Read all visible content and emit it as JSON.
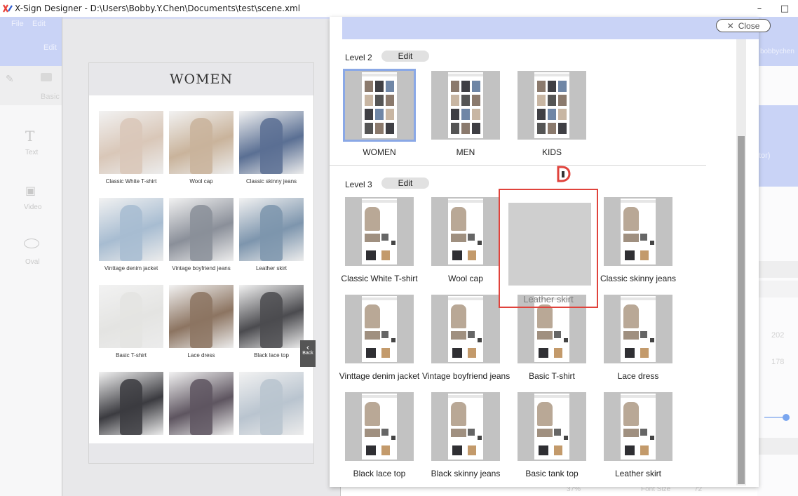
{
  "window": {
    "title": "X-Sign Designer - D:\\Users\\Bobby.Y.Chen\\Documents\\test\\scene.xml",
    "minimize_icon": "–",
    "restore_icon": "□"
  },
  "background_app": {
    "menus": [
      "File",
      "Edit"
    ],
    "edit_button": "Edit",
    "user": "bobbychen",
    "tools": [
      {
        "label": "Basic",
        "icon": "basic-icon"
      },
      {
        "label": "Text",
        "icon": "text-icon"
      },
      {
        "label": "Video",
        "icon": "video-icon"
      },
      {
        "label": "Oval",
        "icon": "oval-icon"
      }
    ],
    "right_panel_text": "tor)",
    "right_values": [
      "202",
      "178"
    ],
    "zoom_text": "37%",
    "font_size_label": "Font Size",
    "font_size_value": "72"
  },
  "preview": {
    "page_title": "WOMEN",
    "back_label": "Back",
    "products": [
      {
        "name": "Classic White T-shirt",
        "tone": "#d9c7b8"
      },
      {
        "name": "Wool cap",
        "tone": "#c9b39b"
      },
      {
        "name": "Classic skinny jeans",
        "tone": "#5a6f93"
      },
      {
        "name": "Vinttage denim jacket",
        "tone": "#a7bcd1"
      },
      {
        "name": "Vintage boyfriend jeans",
        "tone": "#8a8f99"
      },
      {
        "name": "Leather skirt",
        "tone": "#7d95ad"
      },
      {
        "name": "Basic T-shirt",
        "tone": "#e4e4e2"
      },
      {
        "name": "Lace dress",
        "tone": "#8c7461"
      },
      {
        "name": "Black lace top",
        "tone": "#4b4b4f"
      },
      {
        "name": "",
        "tone": "#3b3b40"
      },
      {
        "name": "",
        "tone": "#5e5560"
      },
      {
        "name": "",
        "tone": "#b9c4cf"
      }
    ]
  },
  "dialog": {
    "close_label": "Close",
    "close_icon": "✕",
    "levels": [
      {
        "label": "Level 2",
        "edit_label": "Edit",
        "items": [
          "WOMEN",
          "MEN",
          "KIDS"
        ]
      },
      {
        "label": "Level 3",
        "edit_label": "Edit",
        "items": [
          "Classic White T-shirt",
          "Wool cap",
          "",
          "Classic skinny jeans",
          "Vinttage denim jacket",
          "Vintage boyfriend jeans",
          "Basic T-shirt",
          "Lace dress",
          "Black lace top",
          "Black skinny jeans",
          "Basic tank top",
          "Leather skirt"
        ]
      }
    ],
    "dragging_item": "Leather skirt",
    "selected_level2_item": "WOMEN",
    "accent_color": "#8aa8e6",
    "drop_highlight_color": "#e0433c"
  }
}
